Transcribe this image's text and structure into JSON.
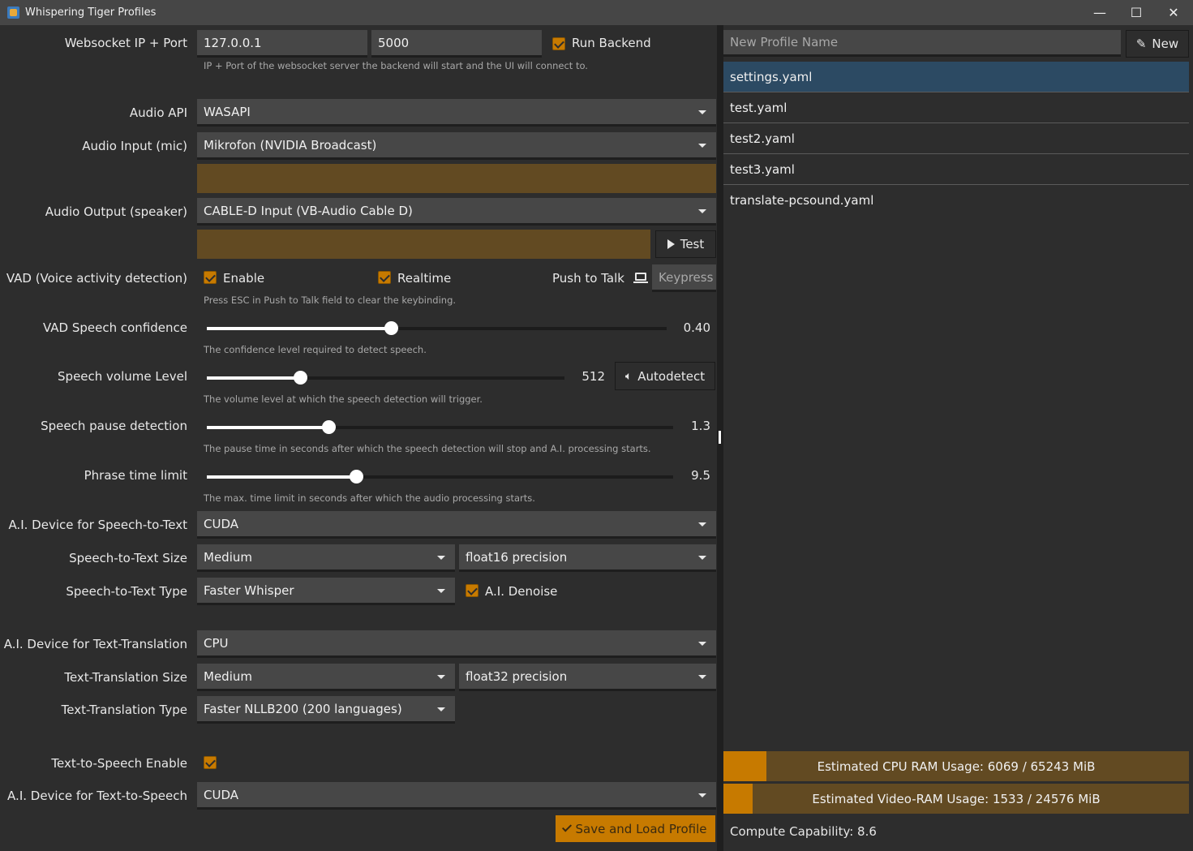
{
  "window": {
    "title": "Whispering Tiger Profiles",
    "controls": {
      "minimize": "—",
      "maximize": "☐",
      "close": "✕"
    }
  },
  "settings": {
    "websocket": {
      "label": "Websocket IP + Port",
      "ip": "127.0.0.1",
      "port": "5000",
      "run_backend_label": "Run Backend",
      "run_backend_checked": true,
      "hint": "IP + Port of the websocket server the backend will start and the UI will connect to."
    },
    "audio_api": {
      "label": "Audio API",
      "value": "WASAPI"
    },
    "audio_input": {
      "label": "Audio Input (mic)",
      "value": "Mikrofon (NVIDIA Broadcast)"
    },
    "audio_output": {
      "label": "Audio Output (speaker)",
      "value": "CABLE-D Input (VB-Audio Cable D)",
      "test_label": "Test"
    },
    "vad": {
      "label": "VAD (Voice activity detection)",
      "enable_label": "Enable",
      "enable_checked": true,
      "realtime_label": "Realtime",
      "realtime_checked": true,
      "push_to_talk_label": "Push to Talk",
      "push_to_talk_placeholder": "Keypress",
      "hint": "Press ESC in Push to Talk field to clear the keybinding."
    },
    "vad_confidence": {
      "label": "VAD Speech confidence",
      "value": "0.40",
      "fraction": 0.4,
      "hint": "The confidence level required to detect speech."
    },
    "speech_volume": {
      "label": "Speech volume Level",
      "value": "512",
      "fraction": 0.26,
      "autodetect_label": "Autodetect",
      "hint": "The volume level at which the speech detection will trigger."
    },
    "speech_pause": {
      "label": "Speech pause detection",
      "value": "1.3",
      "fraction": 0.26,
      "hint": "The pause time in seconds after which the speech detection will stop and A.I. processing starts."
    },
    "phrase_limit": {
      "label": "Phrase time limit",
      "value": "9.5",
      "fraction": 0.32,
      "hint": "The max. time limit in seconds after which the audio processing starts."
    },
    "stt_device": {
      "label": "A.I. Device for Speech-to-Text",
      "value": "CUDA"
    },
    "stt_size": {
      "label": "Speech-to-Text Size",
      "value": "Medium",
      "precision": "float16 precision"
    },
    "stt_type": {
      "label": "Speech-to-Text Type",
      "value": "Faster Whisper",
      "denoise_label": "A.I. Denoise",
      "denoise_checked": true
    },
    "tt_device": {
      "label": "A.I. Device for Text-Translation",
      "value": "CPU"
    },
    "tt_size": {
      "label": "Text-Translation Size",
      "value": "Medium",
      "precision": "float32 precision"
    },
    "tt_type": {
      "label": "Text-Translation Type",
      "value": "Faster NLLB200 (200 languages)"
    },
    "tts_enable": {
      "label": "Text-to-Speech Enable",
      "checked": true
    },
    "tts_device": {
      "label": "A.I. Device for Text-to-Speech",
      "value": "CUDA"
    },
    "save_label": "Save and Load Profile"
  },
  "profiles": {
    "new_name_placeholder": "New Profile Name",
    "new_label": "New",
    "items": [
      {
        "name": "settings.yaml",
        "selected": true
      },
      {
        "name": "test.yaml",
        "selected": false
      },
      {
        "name": "test2.yaml",
        "selected": false
      },
      {
        "name": "test3.yaml",
        "selected": false
      },
      {
        "name": "translate-pcsound.yaml",
        "selected": false
      }
    ],
    "cpu_ram": {
      "text": "Estimated CPU RAM Usage: 6069 / 65243 MiB",
      "used": 6069,
      "total": 65243
    },
    "vram": {
      "text": "Estimated Video-RAM Usage: 1533 / 24576 MiB",
      "used": 1533,
      "total": 24576
    },
    "compute_capability": "Compute Capability: 8.6"
  },
  "colors": {
    "accent": "#c77a00",
    "meter_bg": "#624a22",
    "selection": "#2c4a63"
  }
}
